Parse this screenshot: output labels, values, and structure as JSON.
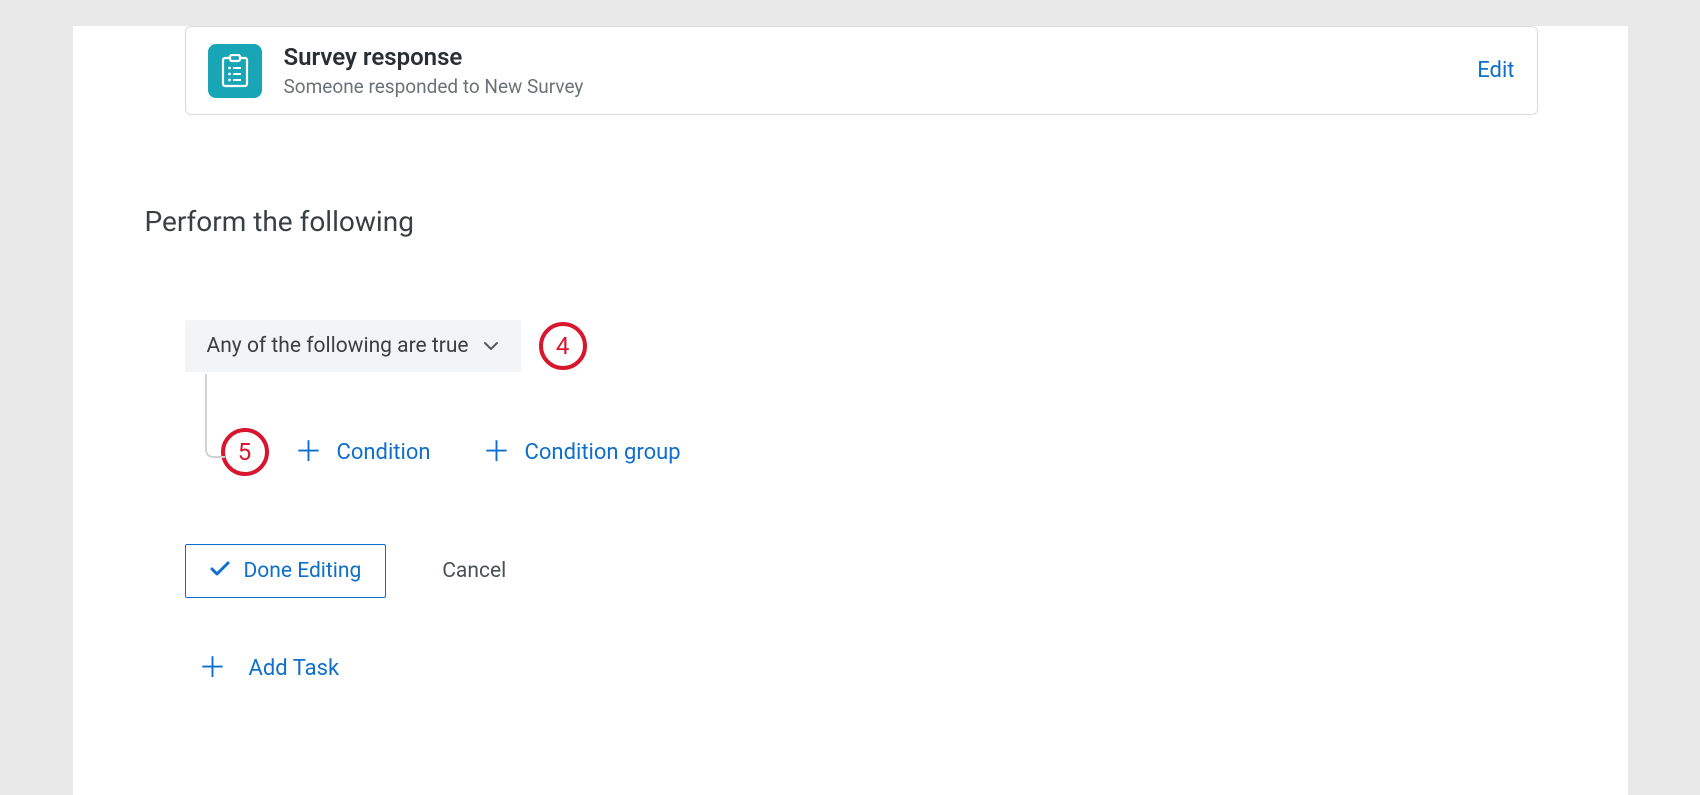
{
  "trigger": {
    "title": "Survey response",
    "subtitle": "Someone responded to New Survey",
    "edit_label": "Edit"
  },
  "section": {
    "title": "Perform the following"
  },
  "logic": {
    "dropdown_label": "Any of the following are true",
    "callout_4": "4",
    "callout_5": "5",
    "add_condition_label": "Condition",
    "add_condition_group_label": "Condition group"
  },
  "actions": {
    "done_label": "Done Editing",
    "cancel_label": "Cancel",
    "add_task_label": "Add Task"
  }
}
